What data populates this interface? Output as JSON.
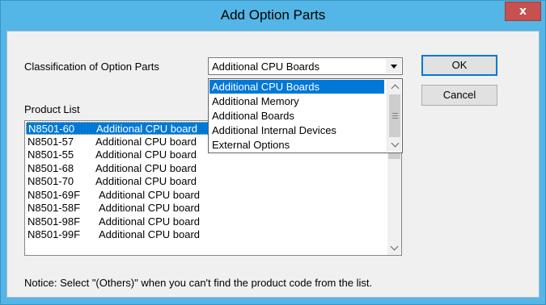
{
  "window": {
    "title": "Add Option Parts",
    "close_glyph": "x"
  },
  "classification": {
    "label": "Classification of Option Parts",
    "selected": "Additional CPU Boards",
    "options": [
      "Additional CPU Boards",
      "Additional Memory",
      "Additional Boards",
      "Additional Internal Devices",
      "External Options"
    ]
  },
  "buttons": {
    "ok": "OK",
    "cancel": "Cancel"
  },
  "product_list": {
    "label": "Product List",
    "items": [
      {
        "code": "N8501-60",
        "desc": "Additional CPU board"
      },
      {
        "code": "N8501-57",
        "desc": "Additional CPU board"
      },
      {
        "code": "N8501-55",
        "desc": "Additional CPU board"
      },
      {
        "code": "N8501-68",
        "desc": "Additional CPU board"
      },
      {
        "code": "N8501-70",
        "desc": "Additional CPU board"
      },
      {
        "code": "N8501-69F",
        "desc": "Additional CPU board"
      },
      {
        "code": "N8501-58F",
        "desc": "Additional CPU board"
      },
      {
        "code": "N8501-98F",
        "desc": "Additional CPU board"
      },
      {
        "code": "N8501-99F",
        "desc": "Additional CPU board"
      }
    ]
  },
  "notice": "Notice: Select \"(Others)\" when you can't find the product code from the list.",
  "colors": {
    "title_bar": "#54b6e6",
    "close_button": "#c75050",
    "selection": "#0078d7"
  }
}
